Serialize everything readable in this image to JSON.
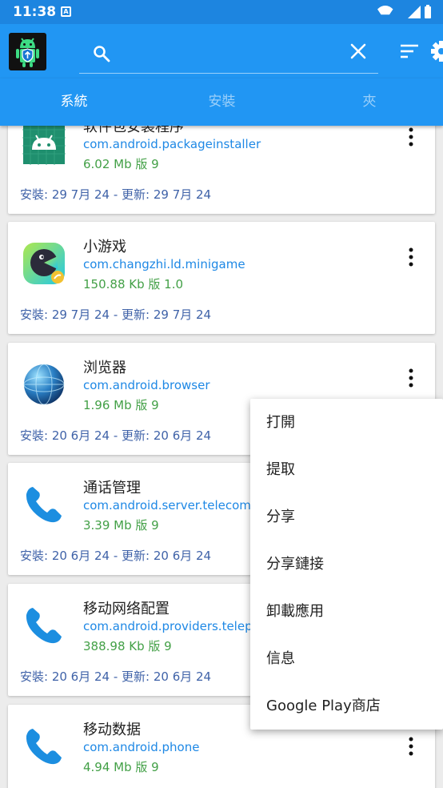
{
  "status_bar": {
    "time": "11:38",
    "notification_glyph": "A"
  },
  "toolbar": {
    "search_placeholder": "",
    "search_value": ""
  },
  "tabs": [
    {
      "label": "系統",
      "active": true
    },
    {
      "label": "安裝",
      "active": false
    },
    {
      "label": "夾",
      "active": false
    }
  ],
  "apps": [
    {
      "name": "软件包安装程序",
      "package": "com.android.packageinstaller",
      "size": "6.02 Mb 版 9",
      "dates": "安裝: 29 7月 24 - 更新: 29 7月 24",
      "icon": "android-robot-icon"
    },
    {
      "name": "小游戏",
      "package": "com.changzhi.ld.minigame",
      "size": "150.88 Kb 版 1.0",
      "dates": "安裝: 29 7月 24 - 更新: 29 7月 24",
      "icon": "minigame-icon"
    },
    {
      "name": "浏览器",
      "package": "com.android.browser",
      "size": "1.96 Mb 版 9",
      "dates": "安裝: 20 6月 24 - 更新: 20 6月 24",
      "icon": "globe-icon"
    },
    {
      "name": "通话管理",
      "package": "com.android.server.telecom",
      "size": "3.39 Mb 版 9",
      "dates": "安裝: 20 6月 24 - 更新: 20 6月 24",
      "icon": "phone-icon"
    },
    {
      "name": "移动网络配置",
      "package": "com.android.providers.telephony",
      "size": "388.98 Kb 版 9",
      "dates": "安裝: 20 6月 24 - 更新: 20 6月 24",
      "icon": "phone-icon"
    },
    {
      "name": "移动数据",
      "package": "com.android.phone",
      "size": "4.94 Mb 版 9",
      "dates": "",
      "icon": "phone-icon"
    }
  ],
  "context_menu": [
    "打開",
    "提取",
    "分享",
    "分享鏈接",
    "卸載應用",
    "信息",
    "Google Play商店"
  ],
  "colors": {
    "primary": "#2196f3",
    "status_bar": "#1d85e0",
    "package_text": "#1e88e5",
    "size_text": "#43a047",
    "date_text": "#3f62a8"
  }
}
